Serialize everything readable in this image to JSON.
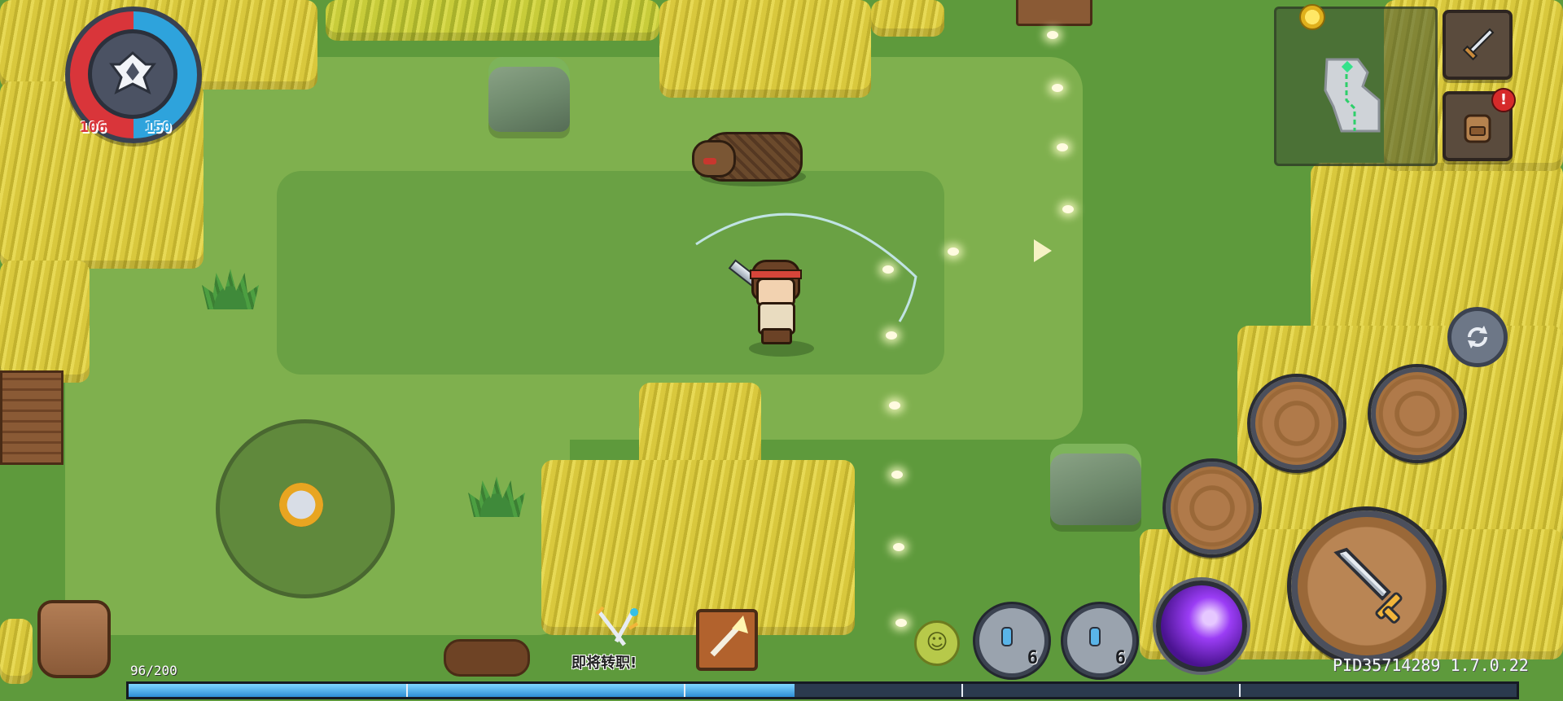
{
  "player": {
    "hp": "106",
    "mp": "150",
    "hp_color": "#d9353a",
    "mp_color": "#2ea3dc"
  },
  "hud": {
    "xp_text": "96/200",
    "xp_progress": 0.48,
    "job_change_label": "即将转职!",
    "potion_1_count": "6",
    "potion_2_count": "6",
    "version": "PID35714289 1.7.0.22",
    "inventory_alert": "!"
  },
  "icons": {
    "class_emblem": "class-emblem-icon",
    "weapon": "sword-icon",
    "backpack": "backpack-icon",
    "swap": "swap-icon",
    "coin": "coin-icon"
  }
}
